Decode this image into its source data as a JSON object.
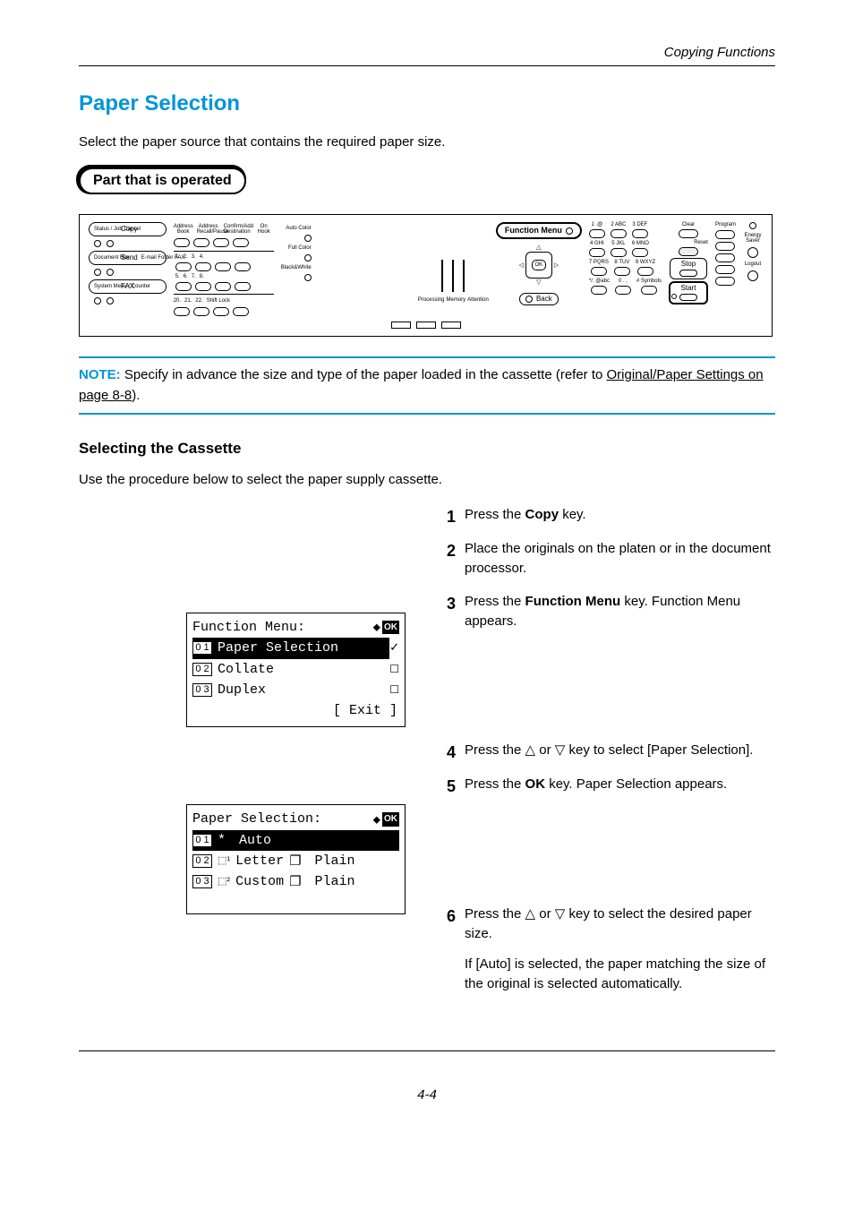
{
  "running_head": "Copying Functions",
  "title": "Paper Selection",
  "intro": "Select the paper source that contains the required paper size.",
  "part_tab": "Part that is operated",
  "panel": {
    "status": "Status / Job Cancel",
    "copy": "Copy",
    "document_box": "Document Box",
    "send": "Send",
    "send_sub": "E-mail Folder FAX",
    "sysmenu": "System Menu / Counter",
    "fax": "FAX",
    "addr_book": "Address Book",
    "addr_recall": "Address Recall/Pause",
    "confirm": "Confirm/Add Destination",
    "onhook": "On Hook",
    "auto_color": "Auto Color",
    "full_color": "Full Color",
    "bw": "Black&White",
    "shift": "Shift Lock",
    "func_menu": "Function Menu",
    "back": "Back",
    "leds": {
      "a": "Processing",
      "b": "Memory",
      "c": "Attention"
    },
    "keys": {
      "k1": "1 .@",
      "k2": "2 ABC",
      "k3": "3 DEF",
      "k4": "4 GHI",
      "k5": "5 JKL",
      "k6": "6 MNO",
      "k7": "7 PQRS",
      "k8": "8 TUV",
      "k9": "9 WXYZ",
      "kstar": "*/. @abc",
      "k0": "0 . ,",
      "khash": "# Symbols"
    },
    "clear": "Clear",
    "reset": "Reset",
    "stop": "Stop",
    "start": "Start",
    "program": "Program",
    "energy": "Energy Saver",
    "logout": "Logout"
  },
  "note": {
    "label": "NOTE:",
    "text_a": " Specify in advance the size and type of the paper loaded in the cassette (refer to ",
    "xref": "Original/Paper Settings on page 8-8",
    "text_b": ")."
  },
  "subhead": "Selecting the Cassette",
  "sub_intro": "Use the procedure below to select the paper supply cassette.",
  "lcd1": {
    "title": "Function Menu:",
    "r1_num": "0 1",
    "r1": "Paper Selection",
    "r2_num": "0 2",
    "r2": "Collate",
    "r3_num": "0 3",
    "r3": "Duplex",
    "exit": "[  Exit  ]"
  },
  "lcd2": {
    "title": "Paper Selection:",
    "r1_num": "0 1",
    "r1_star": "*",
    "r1": " Auto",
    "r2_num": "0 2",
    "r2_a": "Letter",
    "r2_b": " Plain",
    "r3_num": "0 3",
    "r3_a": "Custom",
    "r3_b": " Plain"
  },
  "steps": {
    "s1a": "Press the ",
    "s1b": "Copy",
    "s1c": " key.",
    "s2": "Place the originals on the platen or in the document processor.",
    "s3a": "Press the ",
    "s3b": "Function Menu",
    "s3c": " key. Function Menu appears.",
    "s4a": "Press the ",
    "s4b": " or ",
    "s4c": " key to select [Paper Selection].",
    "s5a": "Press the ",
    "s5b": "OK",
    "s5c": " key. Paper Selection appears.",
    "s6a": "Press the ",
    "s6b": " or ",
    "s6c": " key to select the desired paper size.",
    "s6p": "If [Auto] is selected, the paper matching the size of the original is selected automatically."
  },
  "page_num": "4-4"
}
